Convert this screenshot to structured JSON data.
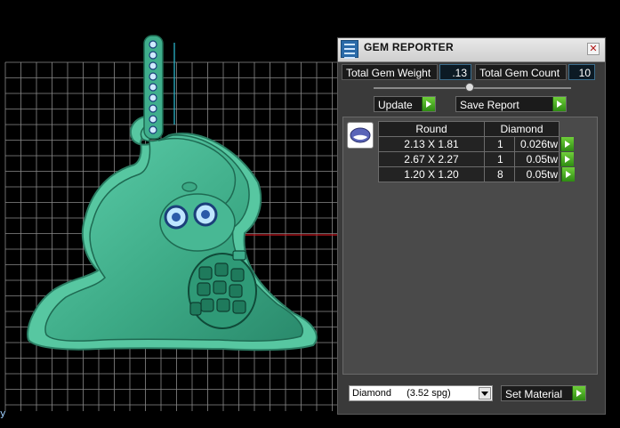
{
  "viewport": {
    "axis_label": "y",
    "colors": {
      "grid": "#8a8a8a",
      "model": "#3fae8c",
      "model_dark": "#1e6a52",
      "axis_red": "#c0121a",
      "axis_cyan": "#2ab3c8"
    }
  },
  "panel": {
    "title": "GEM REPORTER",
    "total_weight_label": "Total Gem Weight",
    "total_weight_value": ".13",
    "total_count_label": "Total Gem Count",
    "total_count_value": "10",
    "update_label": "Update",
    "save_label": "Save Report",
    "table": {
      "header_shape": "Round",
      "header_material": "Diamond",
      "rows": [
        {
          "size": "2.13 X 1.81",
          "qty": "1",
          "weight": "0.026tw"
        },
        {
          "size": "2.67 X 2.27",
          "qty": "1",
          "weight": "0.05tw"
        },
        {
          "size": "1.20 X 1.20",
          "qty": "8",
          "weight": "0.05tw"
        }
      ]
    },
    "material_select": {
      "value": "Diamond",
      "spg": "(3.52 spg)"
    },
    "set_material_label": "Set Material",
    "accent_green": "#4cbb2a"
  }
}
